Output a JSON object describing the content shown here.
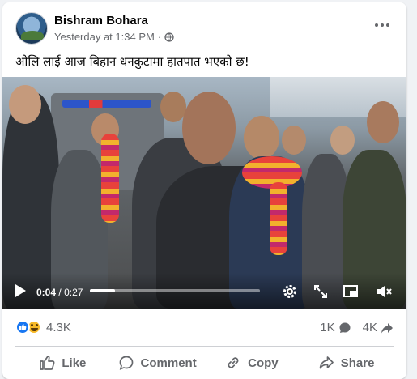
{
  "post": {
    "author": "Bishram Bohara",
    "timestamp": "Yesterday at 1:34 PM",
    "separator": "·",
    "audience_icon": "globe-icon",
    "text": "ओलि लाई आज बिहान धनकुटामा  हातपात भएको  छ!"
  },
  "video": {
    "current_time": "0:04",
    "time_separator": "/",
    "duration": "0:27",
    "progress_fraction": 0.148
  },
  "stats": {
    "reaction_count": "4.3K",
    "comment_count": "1K",
    "share_count": "4K",
    "reactions": [
      "like",
      "haha"
    ]
  },
  "actions": {
    "like": "Like",
    "comment": "Comment",
    "copy": "Copy",
    "share": "Share"
  },
  "colors": {
    "accent": "#1877f2",
    "secondary_text": "#65676b",
    "haha": "#f7b928"
  }
}
